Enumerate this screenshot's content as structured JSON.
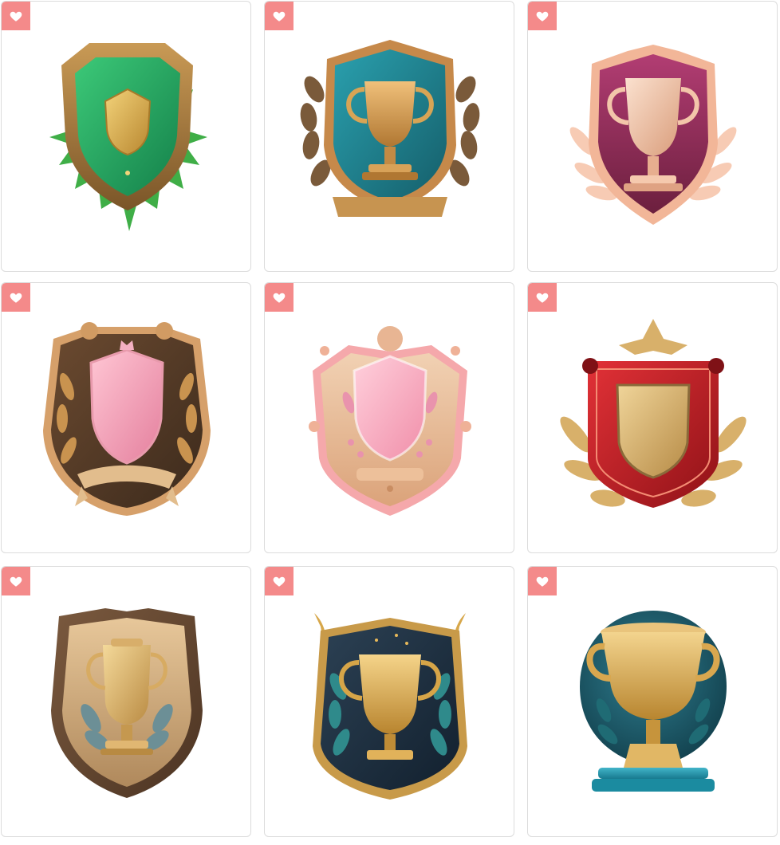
{
  "gallery": {
    "items": [
      {
        "icon": "green-shield-badge-icon",
        "favorite": "heart-icon",
        "colors": {
          "primary": "#2fb36a",
          "accent": "#d9a545"
        }
      },
      {
        "icon": "teal-trophy-laurel-badge-icon",
        "favorite": "heart-icon",
        "colors": {
          "primary": "#1f7f8c",
          "accent": "#d29a4a"
        }
      },
      {
        "icon": "pink-trophy-badge-icon",
        "favorite": "heart-icon",
        "colors": {
          "primary": "#8b2a55",
          "accent": "#f4c2a6"
        }
      },
      {
        "icon": "pink-shield-laurel-badge-icon",
        "favorite": "heart-icon",
        "colors": {
          "primary": "#f3a2b8",
          "accent": "#c98d52"
        }
      },
      {
        "icon": "pink-shield-crest-badge-icon",
        "favorite": "heart-icon",
        "colors": {
          "primary": "#f6b3c4",
          "accent": "#e6b08a"
        }
      },
      {
        "icon": "red-gold-shield-badge-icon",
        "favorite": "heart-icon",
        "colors": {
          "primary": "#c51e25",
          "accent": "#d8b16a"
        }
      },
      {
        "icon": "brown-trophy-shield-badge-icon",
        "favorite": "heart-icon",
        "colors": {
          "primary": "#6d4d34",
          "accent": "#e2bf7a"
        }
      },
      {
        "icon": "dark-trophy-shield-badge-icon",
        "favorite": "heart-icon",
        "colors": {
          "primary": "#1d2d3f",
          "accent": "#d7a74a"
        }
      },
      {
        "icon": "teal-trophy-medallion-icon",
        "favorite": "heart-icon",
        "colors": {
          "primary": "#1c5b6b",
          "accent": "#e0b35e"
        }
      }
    ]
  },
  "ui_colors": {
    "favorite_bg": "#f48a8a",
    "card_border": "#dcdcdc"
  }
}
